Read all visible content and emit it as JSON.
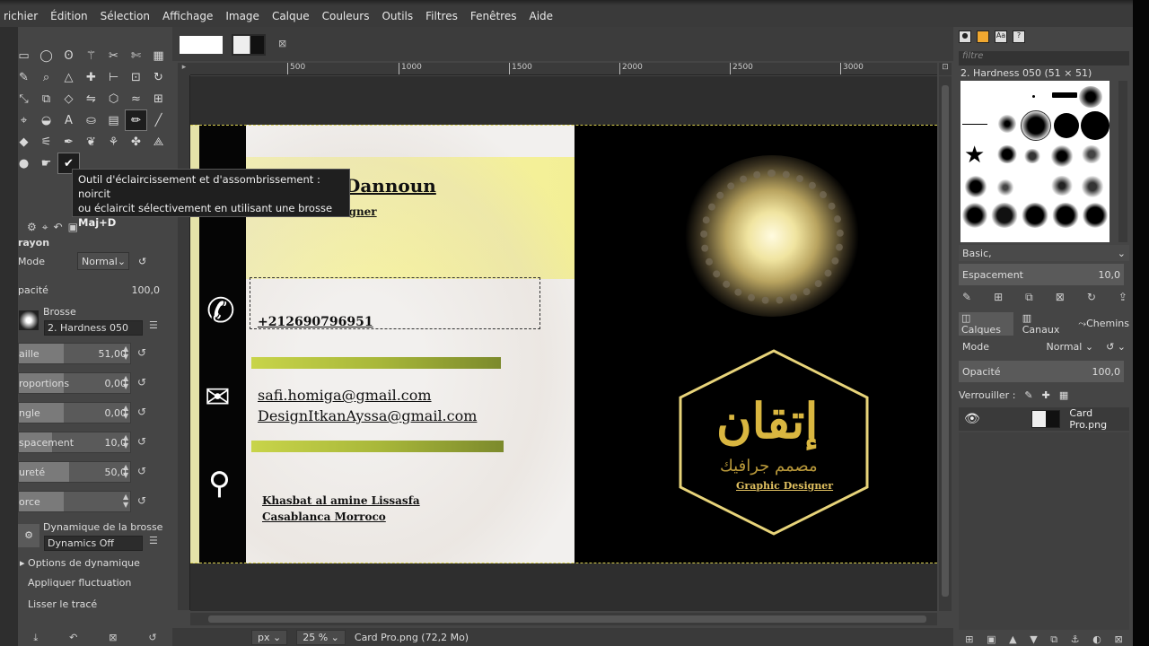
{
  "menu": [
    "Fichier",
    "Édition",
    "Sélection",
    "Affichage",
    "Image",
    "Calque",
    "Couleurs",
    "Outils",
    "Filtres",
    "Fenêtres",
    "Aide"
  ],
  "menu_visible": [
    "richier",
    "Édition",
    "Sélection",
    "Affichage",
    "Image",
    "Calque",
    "Couleurs",
    "Outils",
    "Filtres",
    "Fenêtres",
    "Aide"
  ],
  "tooltip": {
    "line1": "Outil d'éclaircissement et d'assombrissement : noircit",
    "line2": "ou éclaircit sélectivement en utilisant une brosse",
    "shortcut": "Maj+D"
  },
  "tool_options": {
    "title": "rayon",
    "mode_label": "Mode",
    "mode_value": "Normal",
    "opacity_label": "pacité",
    "opacity_value": "100,0",
    "brush_label": "Brosse",
    "brush_value": "2. Hardness 050",
    "size_label": "aille",
    "size_value": "51,00",
    "proportions_label": "roportions",
    "proportions_value": "0,00",
    "angle_label": "ngle",
    "angle_value": "0,00",
    "spacing_label": "spacement",
    "spacing_value": "10,0",
    "hardness_label": "ureté",
    "hardness_value": "50,0",
    "force_label": "orce",
    "dynamics_label": "Dynamique de la brosse",
    "dynamics_value": "Dynamics Off",
    "dyn_options": "Options de dynamique",
    "fluctuation": "Appliquer fluctuation",
    "smooth": "Lisser le tracé"
  },
  "ruler_ticks": [
    {
      "label": "500"
    },
    {
      "label": "1000"
    },
    {
      "label": "1500"
    },
    {
      "label": "2000"
    },
    {
      "label": "2500"
    },
    {
      "label": "3000"
    }
  ],
  "card": {
    "name": "Dannoun",
    "role": "igner",
    "phone": "+212690796951",
    "email1": "safi.homiga@gmail.com",
    "email2": "DesignItkanAyssa@gmail.com",
    "address1": "Khasbat al amine Lissasfa",
    "address2": "Casablanca Morroco",
    "logo_arabic": "إتقان",
    "logo_arabic_sub": "مصمم جرافيك",
    "logo_sub": "Graphic Designer"
  },
  "status": {
    "unit": "px",
    "zoom": "25 %",
    "file": "Card Pro.png (72,2 Mo)"
  },
  "right_panel": {
    "filter_placeholder": "filtre",
    "brush_name": "2. Hardness 050 (51 × 51)",
    "brush_set": "Basic,",
    "spacing_label": "Espacement",
    "spacing_value": "10,0",
    "tabs": [
      "Calques",
      "Canaux",
      "Chemins"
    ],
    "mode_label": "Mode",
    "mode_value": "Normal",
    "opacity_label": "Opacité",
    "opacity_value": "100,0",
    "lock_label": "Verrouiller :",
    "layer_name": "Card Pro.png"
  },
  "colors": {
    "panel": "#454545",
    "canvas": "#2e2e2e",
    "yellow_bar": "#f4f1b0",
    "green_bar": "#a9b83a",
    "gold": "#d9b640"
  }
}
